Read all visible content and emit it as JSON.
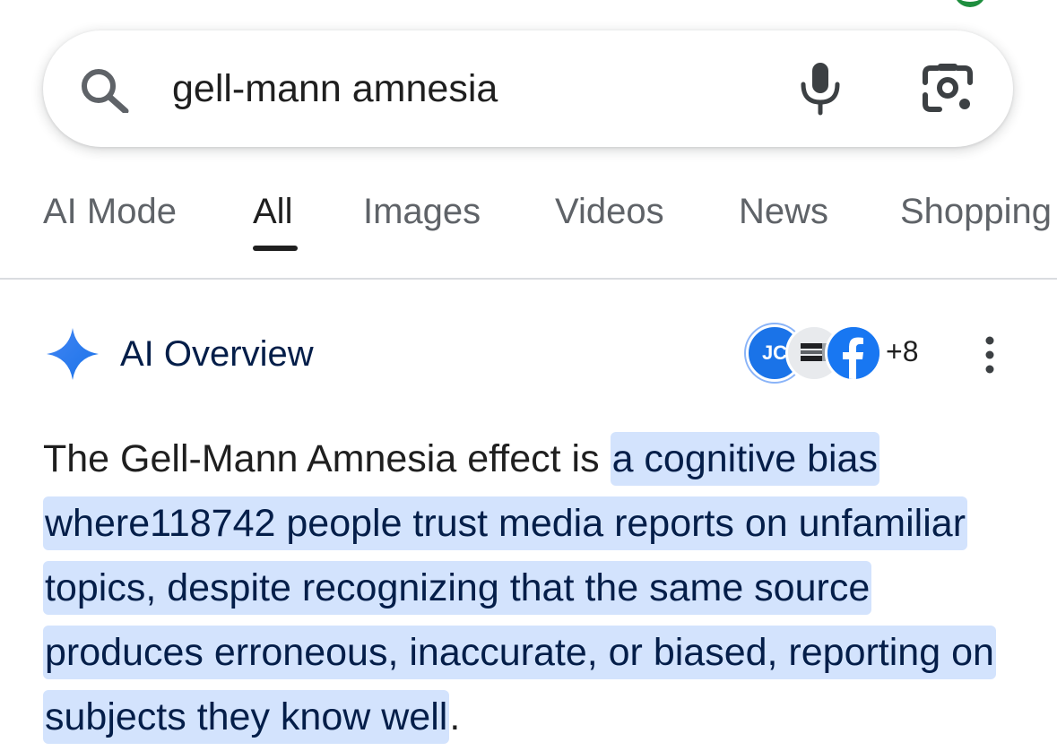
{
  "search": {
    "query": "gell-mann amnesia",
    "icons": {
      "search": "search-icon",
      "mic": "microphone-icon",
      "lens": "google-lens-icon"
    }
  },
  "tabs": [
    {
      "label": "AI Mode",
      "active": false
    },
    {
      "label": "All",
      "active": true
    },
    {
      "label": "Images",
      "active": false
    },
    {
      "label": "Videos",
      "active": false
    },
    {
      "label": "News",
      "active": false
    },
    {
      "label": "Shopping",
      "active": false
    }
  ],
  "ai_overview": {
    "title": "AI Overview",
    "sources": {
      "first_initials": "JC",
      "more_count": "+8"
    },
    "text_prefix": "The Gell-Mann Amnesia effect is ",
    "text_highlight": "a cognitive bias where118742 people trust media reports on unfamiliar topics, despite recognizing that the same source produces erroneous, inaccurate, or biased, reporting on subjects they know well",
    "text_suffix": "."
  },
  "colors": {
    "accent_blue": "#1a73e8",
    "highlight": "#d3e3fd",
    "tab_inactive": "#5f6368",
    "text": "#1f1f1f"
  }
}
